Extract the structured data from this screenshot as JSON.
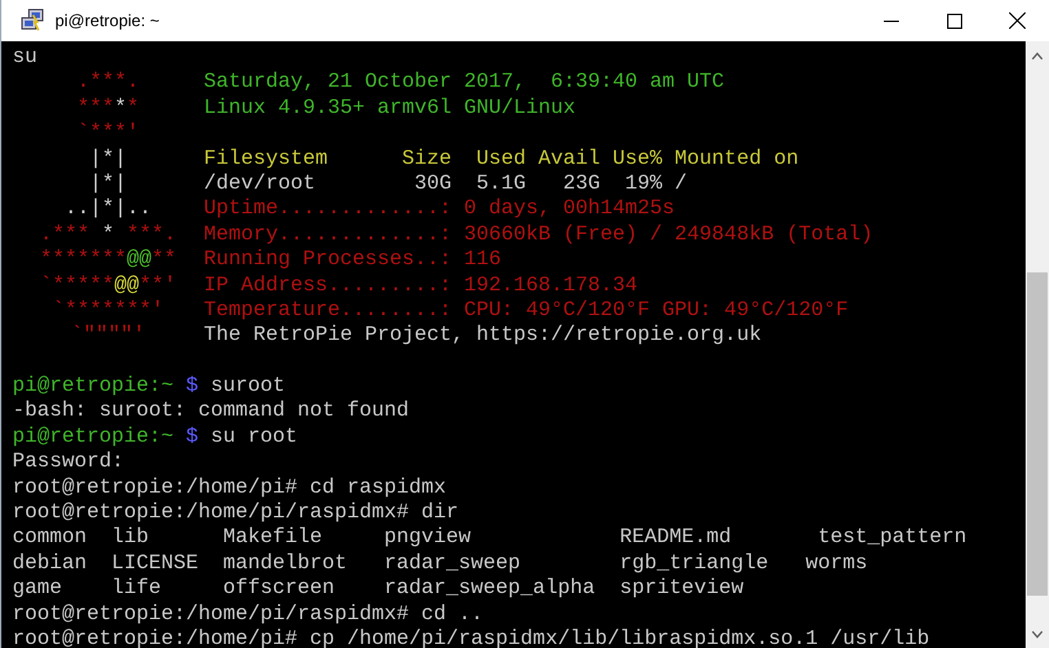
{
  "window": {
    "title": "pi@retropie: ~"
  },
  "first_line": {
    "kind": "output",
    "segments": [
      {
        "text": "su",
        "color": "#c8c8c8"
      }
    ]
  },
  "motd": {
    "logo": [
      [
        {
          "text": ".***.",
          "kind": "shell"
        }
      ],
      [
        {
          "text": "***",
          "kind": "shell"
        },
        {
          "text": "*",
          "kind": "core"
        },
        {
          "text": "*",
          "kind": "shell"
        }
      ],
      [
        {
          "text": "`***'",
          "kind": "shell"
        }
      ],
      [
        {
          "text": "|*|",
          "kind": "core"
        }
      ],
      [
        {
          "text": "|*|",
          "kind": "core"
        }
      ],
      [
        {
          "text": "..|*|..",
          "kind": "core"
        }
      ],
      [
        {
          "text": ".*** ",
          "kind": "shell"
        },
        {
          "text": "*",
          "kind": "core"
        },
        {
          "text": " ***.",
          "kind": "shell"
        }
      ],
      [
        {
          "text": "*******",
          "kind": "shell"
        },
        {
          "text": "@@",
          "kind": "seed"
        },
        {
          "text": "**",
          "kind": "shell"
        }
      ],
      [
        {
          "text": "`*****",
          "kind": "shell"
        },
        {
          "text": "@@",
          "kind": "glint"
        },
        {
          "text": "**'",
          "kind": "shell"
        }
      ],
      [
        {
          "text": "`*******'",
          "kind": "shell"
        }
      ],
      [
        {
          "text": "`\"\"\"\"'",
          "kind": "shell"
        }
      ]
    ],
    "info": [
      {
        "text": "Saturday, 21 October 2017,  6:39:40 am UTC",
        "kind": "banner"
      },
      {
        "text": "Linux 4.9.35+ armv6l GNU/Linux",
        "kind": "banner"
      },
      {
        "text": "Filesystem      Size  Used Avail Use% Mounted on",
        "kind": "table_header"
      },
      {
        "text": "/dev/root        30G  5.1G   23G  19% /",
        "kind": "plain"
      },
      {
        "text": "Uptime.............: 0 days, 00h14m25s",
        "kind": "stat"
      },
      {
        "text": "Memory.............: 30660kB (Free) / 249848kB (Total)",
        "kind": "stat"
      },
      {
        "text": "Running Processes..: 116",
        "kind": "stat"
      },
      {
        "text": "IP Address.........: 192.168.178.34",
        "kind": "stat"
      },
      {
        "text": "Temperature........: CPU: 49°C/120°F GPU: 49°C/120°F",
        "kind": "stat"
      },
      {
        "text": "The RetroPie Project, https://retropie.org.uk",
        "kind": "plain"
      }
    ]
  },
  "lines": [
    {
      "kind": "prompt",
      "segments": [
        {
          "text": "pi@retropie:~",
          "color": "#3fb52a"
        },
        {
          "text": "$",
          "color": "#5a5aff"
        },
        {
          "text": "suroot",
          "color": "#c8c8c8"
        }
      ]
    },
    {
      "kind": "output",
      "segments": [
        {
          "text": "-bash: suroot: command not found",
          "color": "#c8c8c8"
        }
      ]
    },
    {
      "kind": "prompt",
      "segments": [
        {
          "text": "pi@retropie:~",
          "color": "#3fb52a"
        },
        {
          "text": "$",
          "color": "#5a5aff"
        },
        {
          "text": "su root",
          "color": "#c8c8c8"
        }
      ]
    },
    {
      "kind": "output",
      "segments": [
        {
          "text": "Password:",
          "color": "#c8c8c8"
        }
      ]
    },
    {
      "kind": "output",
      "segments": [
        {
          "text": "root@retropie:/home/pi# cd raspidmx",
          "color": "#c8c8c8"
        }
      ]
    },
    {
      "kind": "output",
      "segments": [
        {
          "text": "root@retropie:/home/pi/raspidmx# dir",
          "color": "#c8c8c8"
        }
      ]
    },
    {
      "kind": "output",
      "segments": [
        {
          "text": "common  lib      Makefile     pngview            README.md       test_pattern",
          "color": "#c8c8c8"
        }
      ]
    },
    {
      "kind": "output",
      "segments": [
        {
          "text": "debian  LICENSE  mandelbrot   radar_sweep        rgb_triangle   worms",
          "color": "#c8c8c8"
        }
      ]
    },
    {
      "kind": "output",
      "segments": [
        {
          "text": "game    life     offscreen    radar_sweep_alpha  spriteview",
          "color": "#c8c8c8"
        }
      ]
    },
    {
      "kind": "output",
      "segments": [
        {
          "text": "root@retropie:/home/pi/raspidmx# cd ..",
          "color": "#c8c8c8"
        }
      ]
    },
    {
      "kind": "output",
      "segments": [
        {
          "text": "root@retropie:/home/pi# cp /home/pi/raspidmx/lib/libraspidmx.so.1 /usr/lib",
          "color": "#c8c8c8"
        }
      ]
    }
  ]
}
